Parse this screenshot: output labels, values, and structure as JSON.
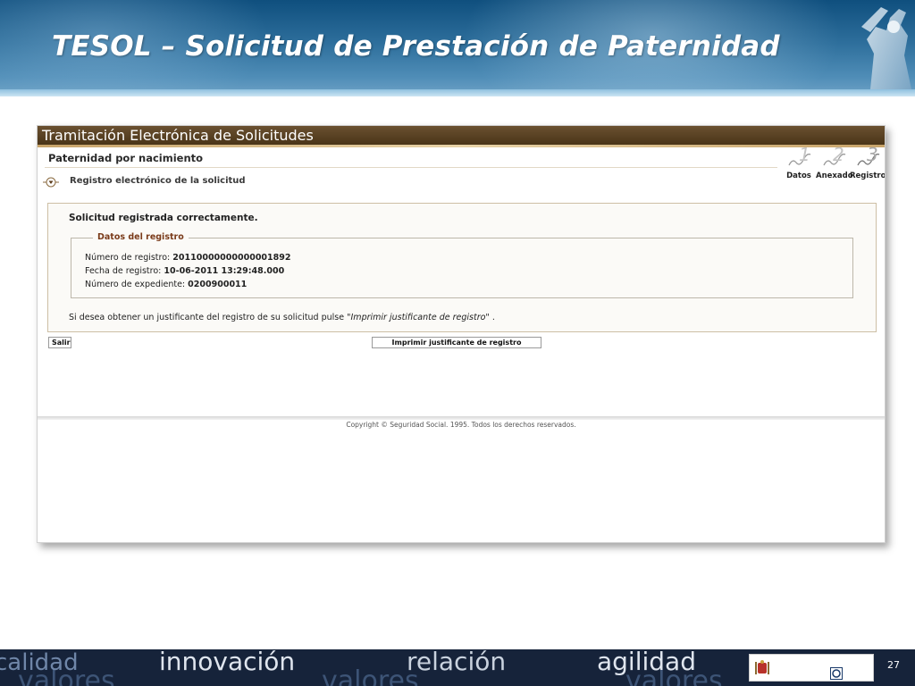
{
  "slide": {
    "title": "TESOL – Solicitud de Prestación de Paternidad",
    "page_number": "27"
  },
  "app": {
    "bar_title": "Tramitación Electrónica de Solicitudes",
    "page_heading": "Paternidad por nacimiento",
    "section_title": "Registro electrónico de la solicitud",
    "steps": [
      {
        "number": "1",
        "label": "Datos"
      },
      {
        "number": "2",
        "label": "Anexado"
      },
      {
        "number": "3",
        "label": "Registro"
      }
    ],
    "panel": {
      "message": "Solicitud registrada correctamente.",
      "legend": "Datos del registro",
      "rows": [
        {
          "label": "Número de registro:",
          "value": "20110000000000001892"
        },
        {
          "label": "Fecha de registro:",
          "value": "10-06-2011 13:29:48.000"
        },
        {
          "label": "Número de expediente:",
          "value": "0200900011"
        }
      ],
      "note_prefix": "Si desea obtener un justificante del registro de su solicitud pulse",
      "note_link": "\"Imprimir justificante de registro\"",
      "note_suffix": "."
    },
    "buttons": {
      "exit": "Salir",
      "print": "Imprimir justificante de registro"
    },
    "copyright": "Copyright © Seguridad Social. 1995. Todos los derechos reservados."
  },
  "bottom_band": {
    "words_top": [
      "calidad",
      "innovación",
      "relación",
      "agilidad"
    ],
    "words_bottom": [
      "valores",
      "valores",
      "valores"
    ]
  },
  "colors": {
    "header_blue": "#2e6f9c",
    "app_bar_brown": "#5a4224",
    "legend_brown": "#7a3b1a",
    "bottom_navy": "#16233a"
  }
}
